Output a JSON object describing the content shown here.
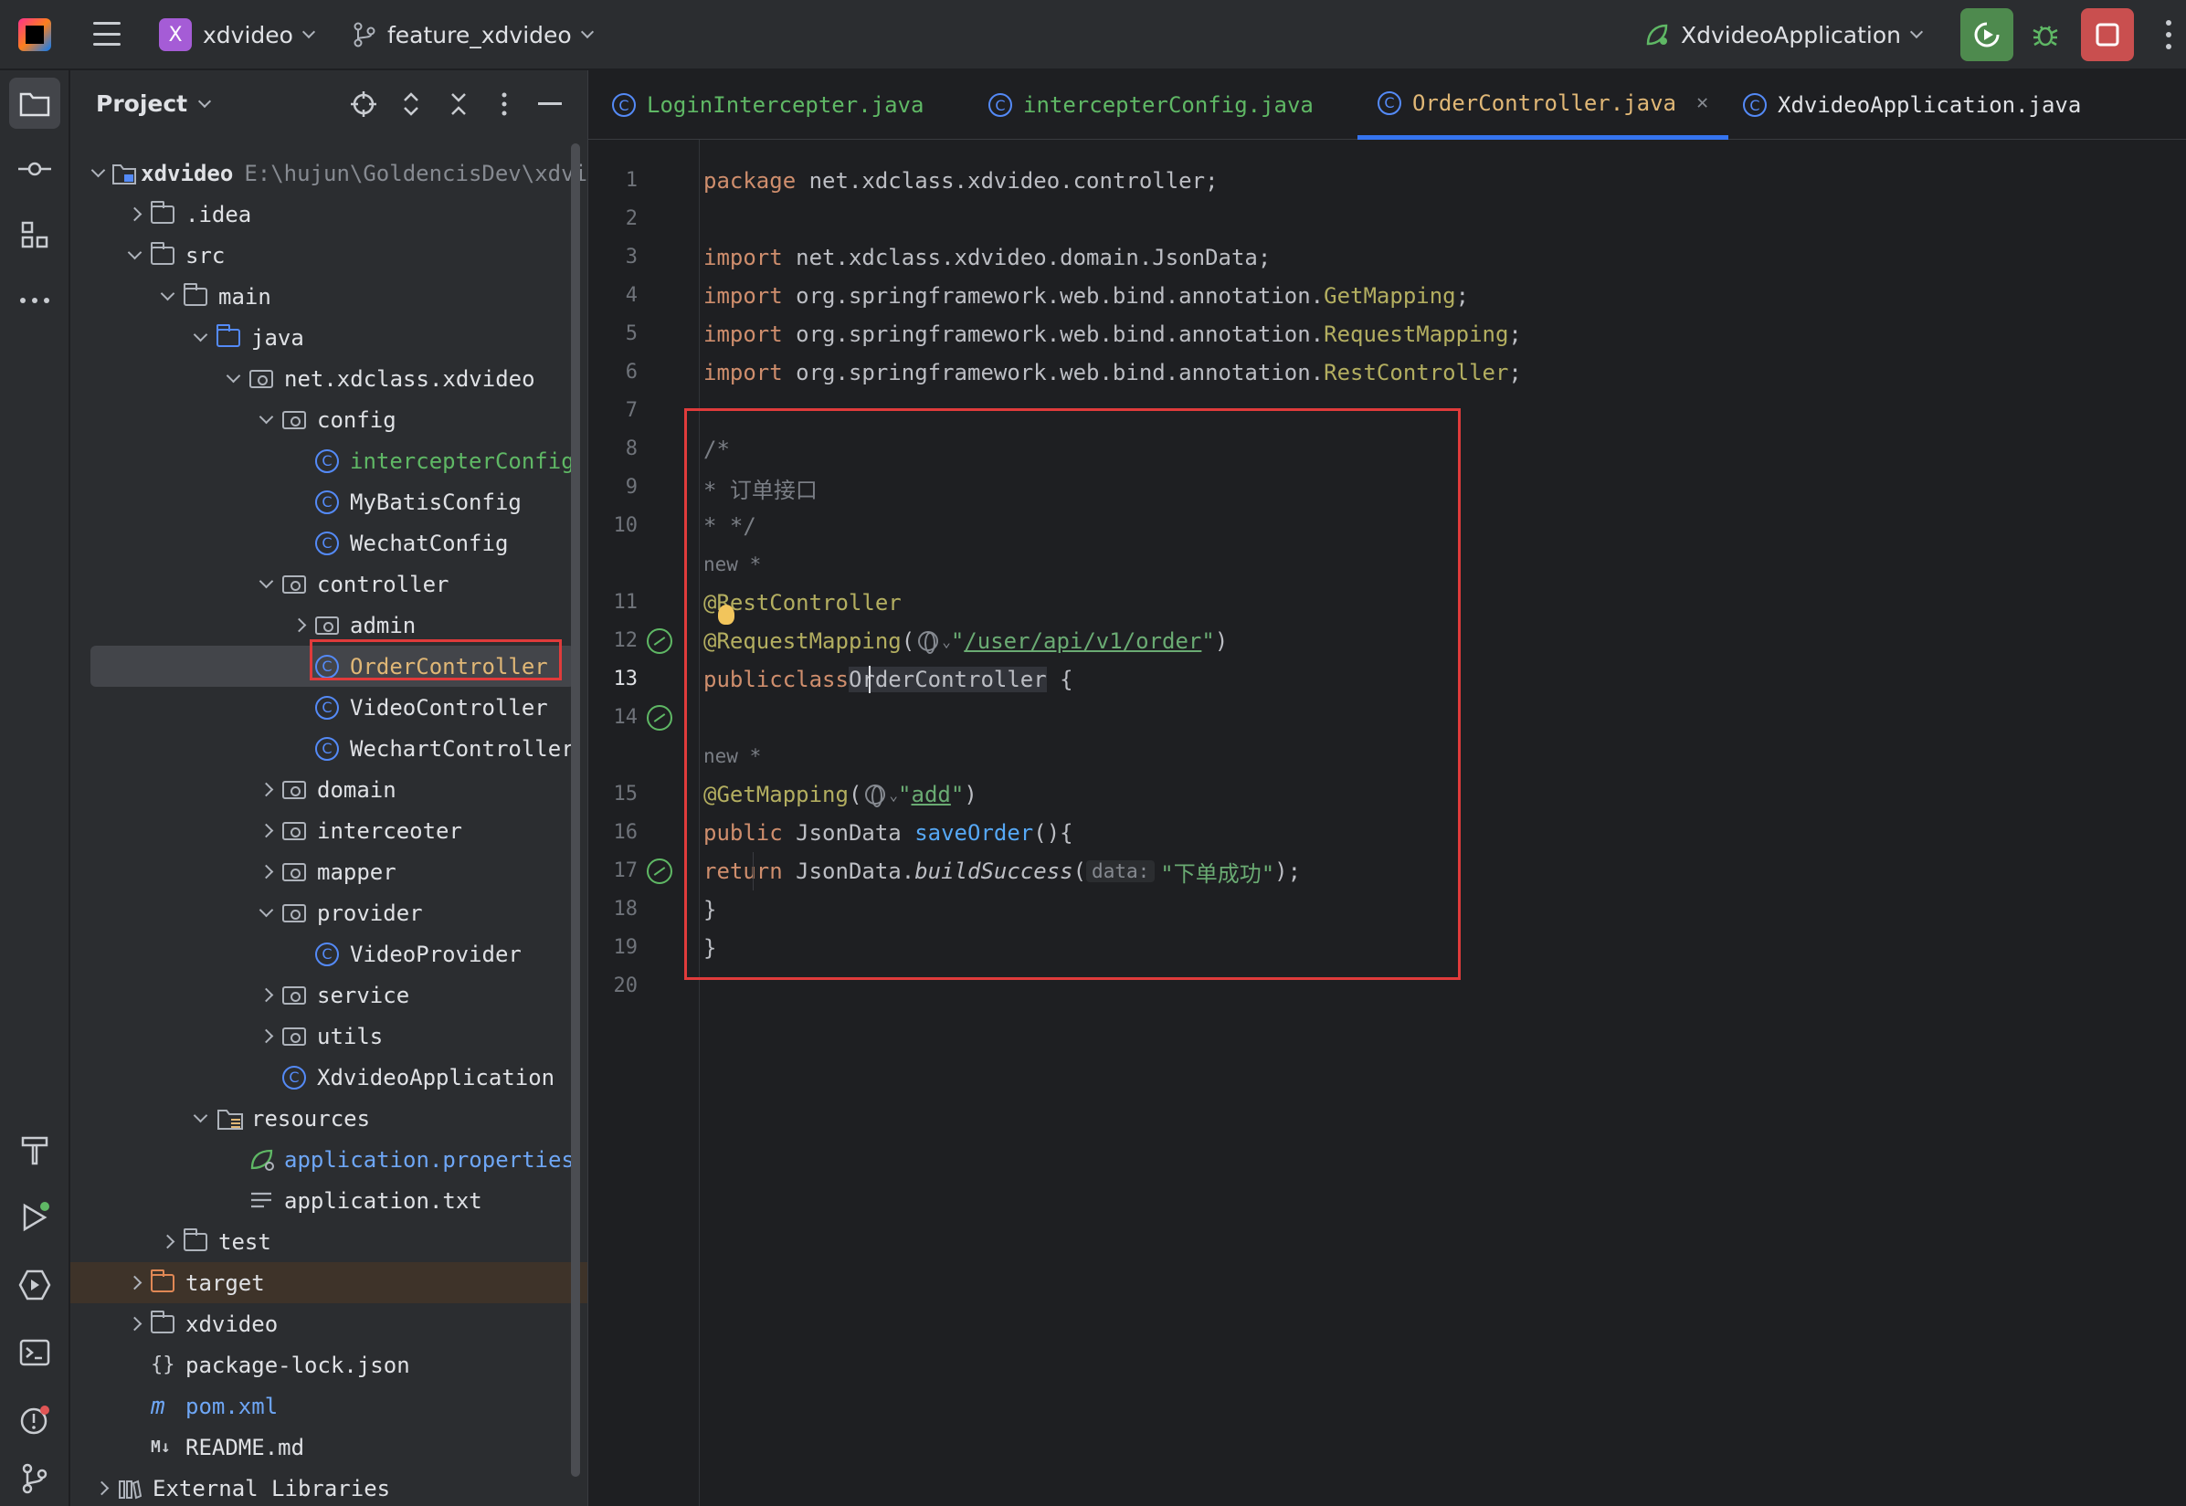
{
  "topbar": {
    "project_badge": "X",
    "project_name": "xdvideo",
    "branch_name": "feature_xdvideo",
    "run_config": "XdvideoApplication"
  },
  "project_panel": {
    "title": "Project",
    "tree": [
      {
        "label": "xdvideo",
        "path": "E:\\hujun\\GoldencisDev\\xdvi",
        "depth": 0,
        "arrow": "down",
        "icon": "module"
      },
      {
        "label": ".idea",
        "depth": 1,
        "arrow": "right",
        "icon": "folder"
      },
      {
        "label": "src",
        "depth": 1,
        "arrow": "down",
        "icon": "folder"
      },
      {
        "label": "main",
        "depth": 2,
        "arrow": "down",
        "icon": "folder"
      },
      {
        "label": "java",
        "depth": 3,
        "arrow": "down",
        "icon": "folder-blue"
      },
      {
        "label": "net.xdclass.xdvideo",
        "depth": 4,
        "arrow": "down",
        "icon": "package"
      },
      {
        "label": "config",
        "depth": 5,
        "arrow": "down",
        "icon": "package"
      },
      {
        "label": "intercepterConfig",
        "depth": 6,
        "arrow": "none",
        "icon": "class",
        "color": "green"
      },
      {
        "label": "MyBatisConfig",
        "depth": 6,
        "arrow": "none",
        "icon": "class"
      },
      {
        "label": "WechatConfig",
        "depth": 6,
        "arrow": "none",
        "icon": "class"
      },
      {
        "label": "controller",
        "depth": 5,
        "arrow": "down",
        "icon": "package"
      },
      {
        "label": "admin",
        "depth": 6,
        "arrow": "right",
        "icon": "package"
      },
      {
        "label": "OrderController",
        "depth": 6,
        "arrow": "none",
        "icon": "class",
        "color": "orange",
        "selected": true
      },
      {
        "label": "VideoController",
        "depth": 6,
        "arrow": "none",
        "icon": "class"
      },
      {
        "label": "WechartController",
        "depth": 6,
        "arrow": "none",
        "icon": "class"
      },
      {
        "label": "domain",
        "depth": 5,
        "arrow": "right",
        "icon": "package"
      },
      {
        "label": "interceoter",
        "depth": 5,
        "arrow": "right",
        "icon": "package"
      },
      {
        "label": "mapper",
        "depth": 5,
        "arrow": "right",
        "icon": "package"
      },
      {
        "label": "provider",
        "depth": 5,
        "arrow": "down",
        "icon": "package"
      },
      {
        "label": "VideoProvider",
        "depth": 6,
        "arrow": "none",
        "icon": "class"
      },
      {
        "label": "service",
        "depth": 5,
        "arrow": "right",
        "icon": "package"
      },
      {
        "label": "utils",
        "depth": 5,
        "arrow": "right",
        "icon": "package"
      },
      {
        "label": "XdvideoApplication",
        "depth": 5,
        "arrow": "none",
        "icon": "class"
      },
      {
        "label": "resources",
        "depth": 3,
        "arrow": "down",
        "icon": "folder-res"
      },
      {
        "label": "application.properties",
        "depth": 4,
        "arrow": "none",
        "icon": "leaf",
        "color": "blue"
      },
      {
        "label": "application.txt",
        "depth": 4,
        "arrow": "none",
        "icon": "text"
      },
      {
        "label": "test",
        "depth": 2,
        "arrow": "right",
        "icon": "folder"
      },
      {
        "label": "target",
        "depth": 1,
        "arrow": "right",
        "icon": "folder-orange",
        "target": true
      },
      {
        "label": "xdvideo",
        "depth": 1,
        "arrow": "right",
        "icon": "folder"
      },
      {
        "label": "package-lock.json",
        "depth": 1,
        "arrow": "none",
        "icon": "json"
      },
      {
        "label": "pom.xml",
        "depth": 1,
        "arrow": "none",
        "icon": "maven",
        "color": "blue"
      },
      {
        "label": "README.md",
        "depth": 1,
        "arrow": "none",
        "icon": "markdown"
      },
      {
        "label": "External Libraries",
        "depth": 0,
        "arrow": "right",
        "icon": "library"
      }
    ]
  },
  "tabs": [
    {
      "label": "LoginIntercepter.java",
      "color": "green"
    },
    {
      "label": "intercepterConfig.java",
      "color": "green"
    },
    {
      "label": "OrderController.java",
      "color": "orange",
      "active": true
    },
    {
      "label": "XdvideoApplication.java",
      "color": "default"
    }
  ],
  "code": {
    "pkg_kw": "package",
    "pkg_name": " net.xdclass.xdvideo.controller;",
    "import_kw": "import",
    "imp1": " net.xdclass.xdvideo.domain.JsonData;",
    "imp2_pre": " org.springframework.web.bind.annotation.",
    "imp2_cls": "GetMapping",
    "imp3_cls": "RequestMapping",
    "imp4_cls": "RestController",
    "semi": ";",
    "cm1": "/*",
    "cm2": "* 订单接口",
    "cm3": "* */",
    "new_hint": "new *",
    "ann_rest": "@RestController",
    "ann_req_at": "@",
    "ann_req": "RequestMapping",
    "req_paren_open": "(",
    "req_str_q": "\"",
    "req_path": "/user/api/v1/order",
    "req_paren_close": ")",
    "public_kw": "public",
    "class_kw": "class",
    "class_name": "OrderController",
    "brace_open": " {",
    "ann_get": "@GetMapping",
    "get_val": "add",
    "ret_type": " JsonData ",
    "method": "saveOrder",
    "method_tail": "(){",
    "return_kw": "return",
    "call_obj": " JsonData.",
    "call_fn": "buildSuccess",
    "inlay_data": "data:",
    "success_str": "\"下单成功\"",
    "call_tail": ");",
    "brace_close": "}",
    "lines": [
      "1",
      "2",
      "3",
      "4",
      "5",
      "6",
      "7",
      "8",
      "9",
      "10",
      "11",
      "12",
      "13",
      "14",
      "15",
      "16",
      "17",
      "18",
      "19",
      "20"
    ]
  }
}
